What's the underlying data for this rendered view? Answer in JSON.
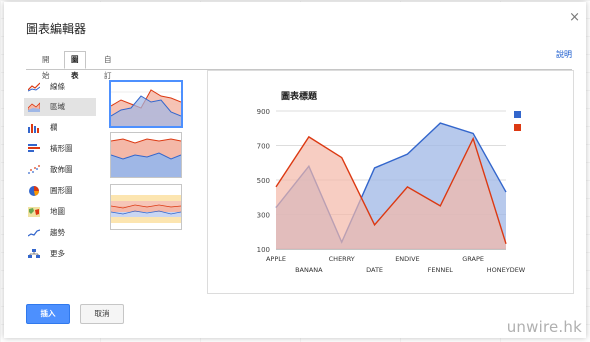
{
  "dialog": {
    "title": "圖表編輯器",
    "close_glyph": "×",
    "help_link": "說明",
    "tabs": [
      {
        "label": "開始"
      },
      {
        "label": "圖表"
      },
      {
        "label": "自訂"
      }
    ],
    "chart_types": [
      {
        "label": "線條",
        "icon": "line-chart-icon"
      },
      {
        "label": "區域",
        "icon": "area-chart-icon"
      },
      {
        "label": "欄",
        "icon": "column-chart-icon"
      },
      {
        "label": "橫形圖",
        "icon": "bar-chart-icon"
      },
      {
        "label": "散佈圖",
        "icon": "scatter-chart-icon"
      },
      {
        "label": "圓形圖",
        "icon": "pie-chart-icon"
      },
      {
        "label": "地圖",
        "icon": "map-chart-icon"
      },
      {
        "label": "趨勢",
        "icon": "trend-chart-icon"
      },
      {
        "label": "更多",
        "icon": "more-charts-icon"
      }
    ],
    "buttons": {
      "insert": "插入",
      "cancel": "取消"
    }
  },
  "watermark": "unwire.hk",
  "colors": {
    "series1": "#3366cc",
    "series2": "#dc3912",
    "accent": "#4d90fe"
  },
  "chart_data": {
    "type": "area",
    "title": "圖表標題",
    "categories": [
      "APPLE",
      "BANANA",
      "CHERRY",
      "DATE",
      "ENDIVE",
      "FENNEL",
      "GRAPE",
      "HONEYDEW"
    ],
    "series": [
      {
        "values": [
          340,
          580,
          140,
          570,
          650,
          830,
          770,
          430
        ]
      },
      {
        "values": [
          460,
          750,
          630,
          240,
          460,
          350,
          740,
          130
        ]
      }
    ],
    "yticks": [
      100,
      300,
      500,
      700,
      900
    ],
    "ylim": [
      100,
      900
    ],
    "legend": "right",
    "grid": true
  }
}
